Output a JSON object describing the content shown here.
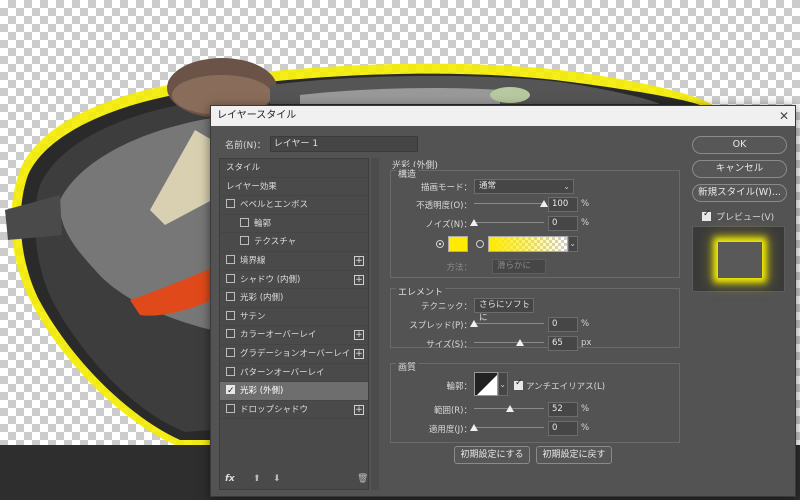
{
  "dialog": {
    "title": "レイヤースタイル",
    "name_label": "名前(N)：",
    "name_value": "レイヤー 1"
  },
  "style_list": {
    "items": [
      {
        "label": "スタイル"
      },
      {
        "label": "レイヤー効果"
      },
      {
        "label": "ベベルとエンボス",
        "checked": false,
        "plus": false
      },
      {
        "label": "輪郭",
        "checked": false,
        "sub": true
      },
      {
        "label": "テクスチャ",
        "checked": false,
        "sub": true
      },
      {
        "label": "境界線",
        "checked": false,
        "plus": true
      },
      {
        "label": "シャドウ (内側)",
        "checked": false,
        "plus": true
      },
      {
        "label": "光彩 (内側)",
        "checked": false
      },
      {
        "label": "サテン",
        "checked": false
      },
      {
        "label": "カラーオーバーレイ",
        "checked": false,
        "plus": true
      },
      {
        "label": "グラデーションオーバーレイ",
        "checked": false,
        "plus": true
      },
      {
        "label": "パターンオーバーレイ",
        "checked": false
      },
      {
        "label": "光彩 (外側)",
        "checked": true,
        "selected": true
      },
      {
        "label": "ドロップシャドウ",
        "checked": false,
        "plus": true
      }
    ],
    "footer": {
      "fx": "fx",
      "up_icon": "arrow-up-icon",
      "down_icon": "arrow-down-icon",
      "trash_icon": "trash-icon"
    }
  },
  "panel": {
    "title": "光彩 (外側)",
    "structure": {
      "title": "構造",
      "blend_label": "描画モード：",
      "blend_value": "通常",
      "opacity_label": "不透明度(O)：",
      "opacity_value": "100",
      "noise_label": "ノイズ(N)：",
      "noise_value": "0",
      "percent": "%",
      "glow_color": "#ffea00",
      "method_label": "方法：",
      "method_value": "滑らかに"
    },
    "elements": {
      "title": "エレメント",
      "technique_label": "テクニック：",
      "technique_value": "さらにソフトに",
      "spread_label": "スプレッド(P)：",
      "spread_value": "0",
      "size_label": "サイズ(S)：",
      "size_value": "65",
      "px": "px",
      "percent": "%"
    },
    "quality": {
      "title": "画質",
      "contour_label": "輪郭：",
      "antialias_label": "アンチエイリアス(L)",
      "antialias_checked": true,
      "range_label": "範囲(R)：",
      "range_value": "52",
      "jitter_label": "適用度(J)：",
      "jitter_value": "0",
      "percent": "%"
    },
    "make_default": "初期設定にする",
    "reset_default": "初期設定に戻す"
  },
  "buttons": {
    "ok": "OK",
    "cancel": "キャンセル",
    "new_style": "新規スタイル(W)...",
    "preview_label": "プレビュー(V)",
    "preview_checked": true
  },
  "levels": {
    "opacity": 100,
    "noise": 0,
    "spread": 0,
    "size": 65,
    "range": 52,
    "jitter": 0
  }
}
